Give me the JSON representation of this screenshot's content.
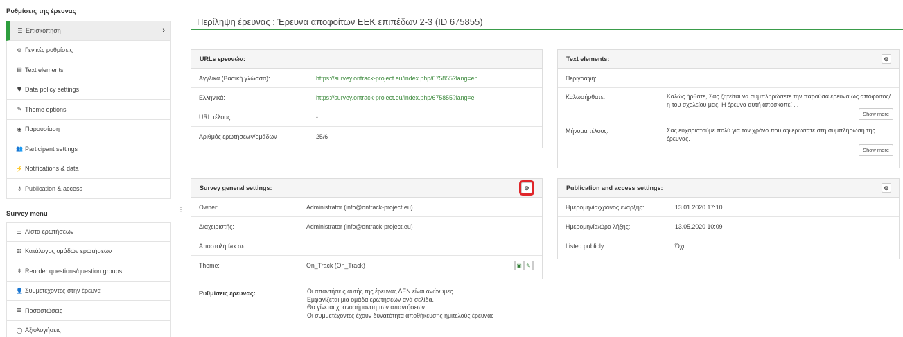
{
  "sidebar": {
    "settings_heading": "Ρυθμίσεις της έρευνας",
    "settings_items": [
      {
        "icon": "list-icon",
        "glyph": "☰",
        "label": "Επισκόπηση",
        "active": true
      },
      {
        "icon": "gears-icon",
        "glyph": "⚙",
        "label": "Γενικές ρυθμίσεις"
      },
      {
        "icon": "file-text-icon",
        "glyph": "▤",
        "label": "Text elements"
      },
      {
        "icon": "shield-icon",
        "glyph": "⛊",
        "label": "Data policy settings"
      },
      {
        "icon": "brush-icon",
        "glyph": "✎",
        "label": "Theme options"
      },
      {
        "icon": "eye-slash-icon",
        "glyph": "◉",
        "label": "Παρουσίαση"
      },
      {
        "icon": "users-icon",
        "glyph": "👥",
        "label": "Participant settings"
      },
      {
        "icon": "rss-icon",
        "glyph": "⚡",
        "label": "Notifications & data"
      },
      {
        "icon": "key-icon",
        "glyph": "⚷",
        "label": "Publication & access"
      }
    ],
    "menu_heading": "Survey menu",
    "menu_items": [
      {
        "icon": "list-icon",
        "glyph": "☰",
        "label": "Λίστα ερωτήσεων"
      },
      {
        "icon": "th-list-icon",
        "glyph": "☷",
        "label": "Κατάλογος ομάδων ερωτήσεων"
      },
      {
        "icon": "reorder-icon",
        "glyph": "⇟",
        "label": "Reorder questions/question groups"
      },
      {
        "icon": "user-icon",
        "glyph": "👤",
        "label": "Συμμετέχοντες στην έρευνα"
      },
      {
        "icon": "list-alt-icon",
        "glyph": "☰",
        "label": "Ποσοστώσεις"
      },
      {
        "icon": "comment-icon",
        "glyph": "◯",
        "label": "Αξιολογήσεις"
      }
    ]
  },
  "page": {
    "title": "Περίληψη έρευνας : Έρευνα αποφοίτων ΕΕΚ επιπέδων 2-3  (ID 675855)"
  },
  "urls_panel": {
    "heading": "URLs ερευνών:",
    "rows": [
      {
        "label": "Αγγλικά (Βασική γλώσσα):",
        "value": "https://survey.ontrack-project.eu/index.php/675855?lang=en"
      },
      {
        "label": "Ελληνικά:",
        "value": "https://survey.ontrack-project.eu/index.php/675855?lang=el"
      },
      {
        "label": "URL τέλους:",
        "value": "-"
      },
      {
        "label": "Αριθμός ερωτήσεων/ομάδων",
        "value": "25/6"
      }
    ]
  },
  "text_panel": {
    "heading": "Text elements:",
    "rows": [
      {
        "label": "Περιγραφή:",
        "value": ""
      },
      {
        "label": "Καλωσήρθατε:",
        "value": "Καλώς ήρθατε, Σας ζητείται να συμπληρώσετε την παρούσα έρευνα ως απόφοιτος/η του σχολείου μας. Η έρευνα αυτή αποσκοπεί ..."
      },
      {
        "label": "Μήνυμα τέλους:",
        "value": "Σας ευχαριστούμε πολύ για τον χρόνο που αφιερώσατε στη συμπλήρωση της έρευνας."
      }
    ],
    "show_more": "Show more"
  },
  "general_panel": {
    "heading": "Survey general settings:",
    "rows": [
      {
        "label": "Owner:",
        "value": "Administrator (info@ontrack-project.eu)"
      },
      {
        "label": "Διαχειριστής:",
        "value": "Administrator (info@ontrack-project.eu)"
      },
      {
        "label": "Αποστολή fax σε:",
        "value": ""
      },
      {
        "label": "Theme:",
        "value": "On_Track (On_Track)"
      }
    ]
  },
  "publication_panel": {
    "heading": "Publication and access settings:",
    "rows": [
      {
        "label": "Ημερομηνία/χρόνος έναρξης:",
        "value": "13.01.2020 17:10"
      },
      {
        "label": "Ημερομηνία/ώρα λήξης:",
        "value": "13.05.2020 10:09"
      },
      {
        "label": "Listed publicly:",
        "value": "Όχι"
      }
    ]
  },
  "survey_settings": {
    "label": "Ρυθμίσεις έρευνας:",
    "lines": [
      "Οι απαντήσεις αυτής της έρευνας ΔΕΝ είναι ανώνυμες",
      "Εμφανίζεται μια ομάδα ερωτήσεων ανά σελίδα.",
      "Θα γίνεται χρονοσήμανση των απαντήσεων.",
      "Οι συμμετέχοντες έχουν δυνατότητα αποθήκευσης ημιτελούς έρευνας"
    ]
  },
  "colors": {
    "accent": "#2e9e3e",
    "link": "#3d8a3d",
    "highlight": "#e0262a"
  }
}
